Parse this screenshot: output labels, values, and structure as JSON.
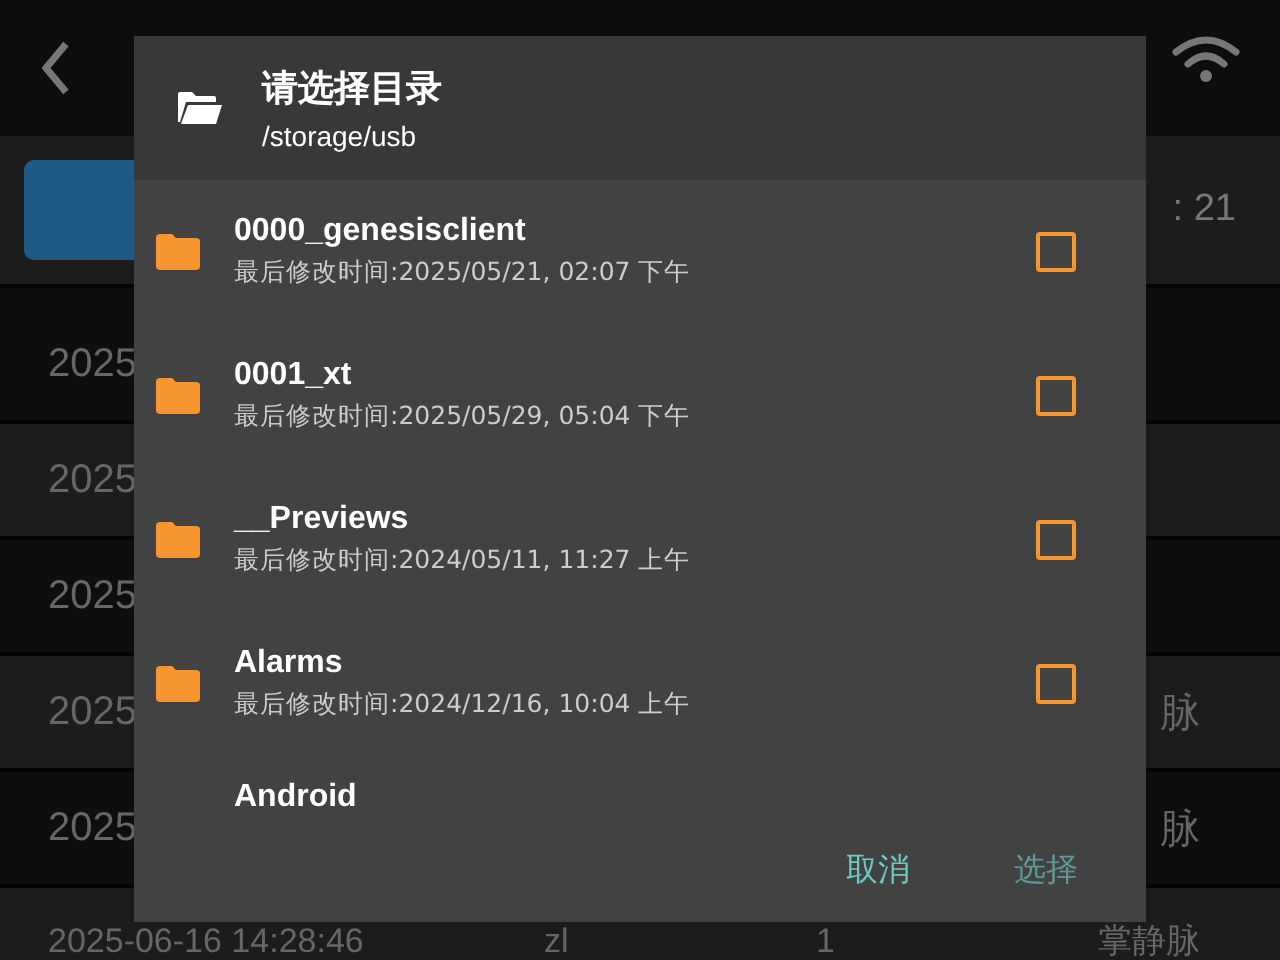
{
  "app": {
    "count": ": 21"
  },
  "records": [
    {
      "time": "2025"
    },
    {
      "time": "2025"
    },
    {
      "time": "2025"
    },
    {
      "time": "2025",
      "type": "脉"
    },
    {
      "time": "2025",
      "type": "脉"
    },
    {
      "time": "2025-06-16 14:28:46",
      "user": "zl",
      "count": "1",
      "type": "掌静脉"
    }
  ],
  "dialog": {
    "title": "请选择目录",
    "path": "/storage/usb",
    "items": [
      {
        "name": "0000_genesisclient",
        "modified": "最后修改时间:2025/05/21, 02:07 下午",
        "checked": false
      },
      {
        "name": "0001_xt",
        "modified": "最后修改时间:2025/05/29, 05:04 下午",
        "checked": false
      },
      {
        "name": "__Previews",
        "modified": "最后修改时间:2024/05/11, 11:27 上午",
        "checked": false
      },
      {
        "name": "Alarms",
        "modified": "最后修改时间:2024/12/16, 10:04 上午",
        "checked": false
      },
      {
        "name": "Android"
      }
    ],
    "buttons": [
      {
        "label": "取消",
        "disabled": false
      },
      {
        "label": "选择",
        "disabled": true
      }
    ]
  }
}
